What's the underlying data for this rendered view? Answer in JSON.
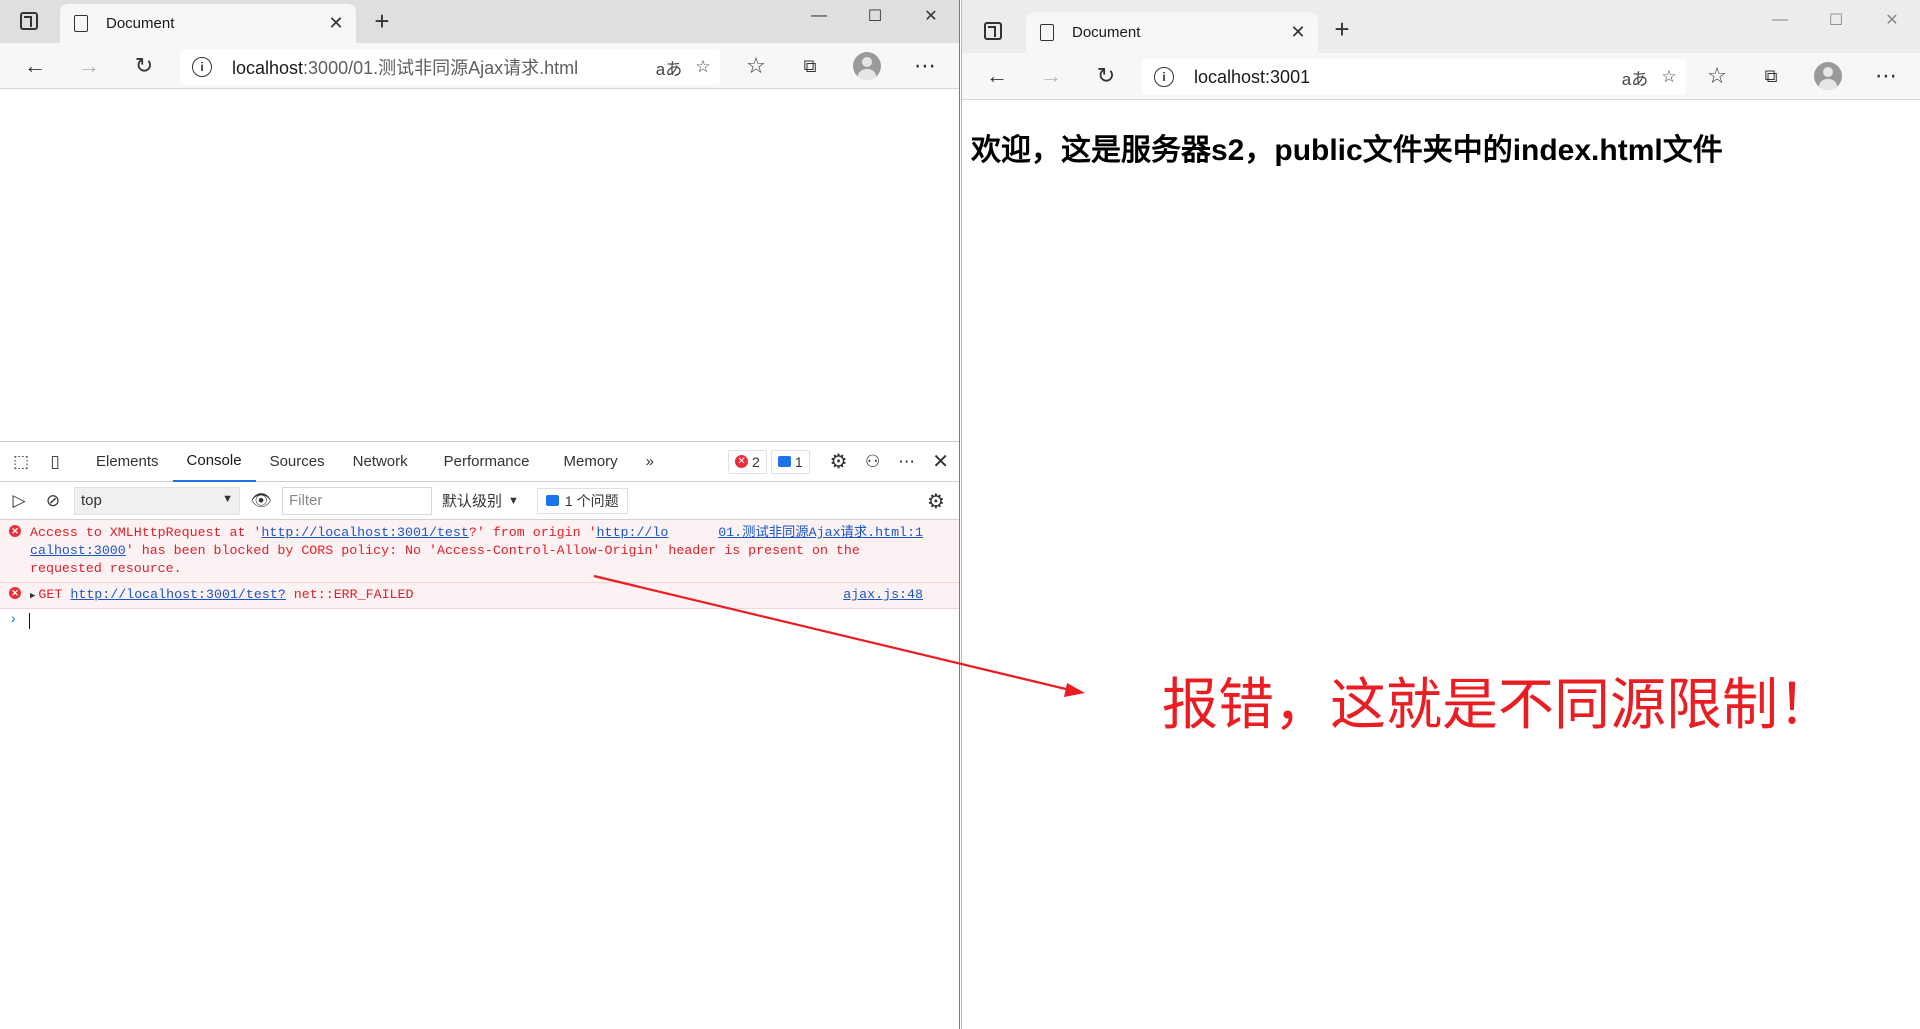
{
  "left_browser": {
    "tab_title": "Document",
    "url_host": "localhost",
    "url_path": ":3000/01.测试非同源Ajax请求.html",
    "read_aloud": "aあ",
    "devtools": {
      "tabs": [
        "Elements",
        "Console",
        "Sources",
        "Network",
        "Performance",
        "Memory"
      ],
      "more_tabs": "»",
      "error_count": "2",
      "message_count": "1",
      "context": "top",
      "filter_placeholder": "Filter",
      "log_level": "默认级别",
      "issues_label": "1 个问题",
      "messages": [
        {
          "type": "error",
          "text_1": "Access to XMLHttpRequest at '",
          "link_1": "http://localhost:3001/test",
          "text_2": "?' from origin '",
          "link_2a": "http://lo",
          "source": "01.测试非同源Ajax请求.html:1",
          "link_2b": "calhost:3000",
          "text_3": "' has been blocked by CORS policy: No 'Access-Control-Allow-Origin' header is present on the",
          "text_4": "requested resource."
        },
        {
          "type": "error",
          "method": "GET",
          "link": "http://localhost:3001/test?",
          "status": "net::ERR_FAILED",
          "source": "ajax.js:48"
        }
      ]
    }
  },
  "right_browser": {
    "tab_title": "Document",
    "url": "localhost:3001",
    "read_aloud": "aあ",
    "page_heading": "欢迎，这是服务器s2，public文件夹中的index.html文件"
  },
  "annotation": {
    "text": "报错，这就是不同源限制！",
    "color": "#ea1d23"
  }
}
